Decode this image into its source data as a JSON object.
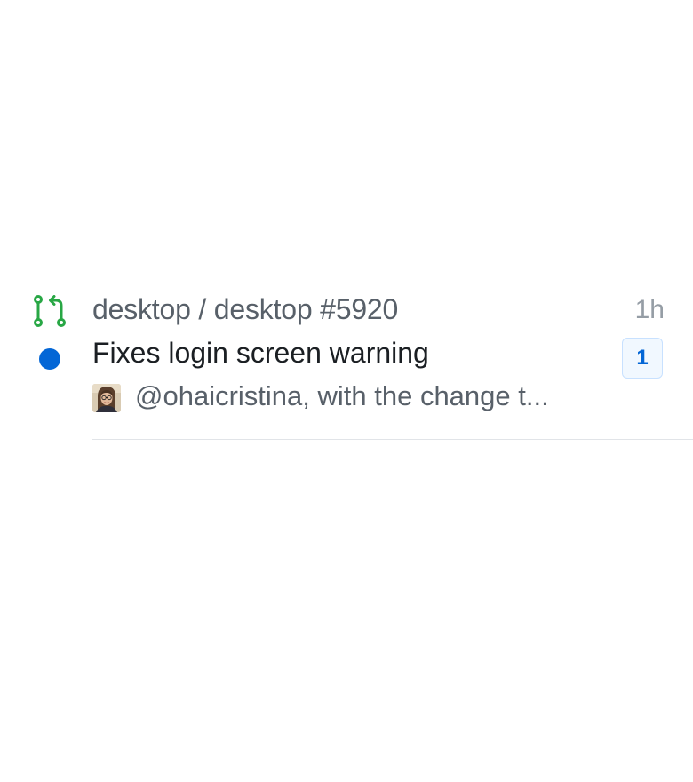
{
  "notification": {
    "type_icon": "git-pull-request-icon",
    "unread": true,
    "repo": "desktop / desktop #5920",
    "time": "1h",
    "title": "Fixes login screen warning",
    "comment_count": "1",
    "snippet": "@ohaicristina, with the change t..."
  },
  "colors": {
    "pr_open": "#28a745",
    "unread_dot": "#0366d6",
    "badge_text": "#0366d6",
    "badge_bg": "#f1f8ff",
    "divider": "#e1e4e8"
  }
}
